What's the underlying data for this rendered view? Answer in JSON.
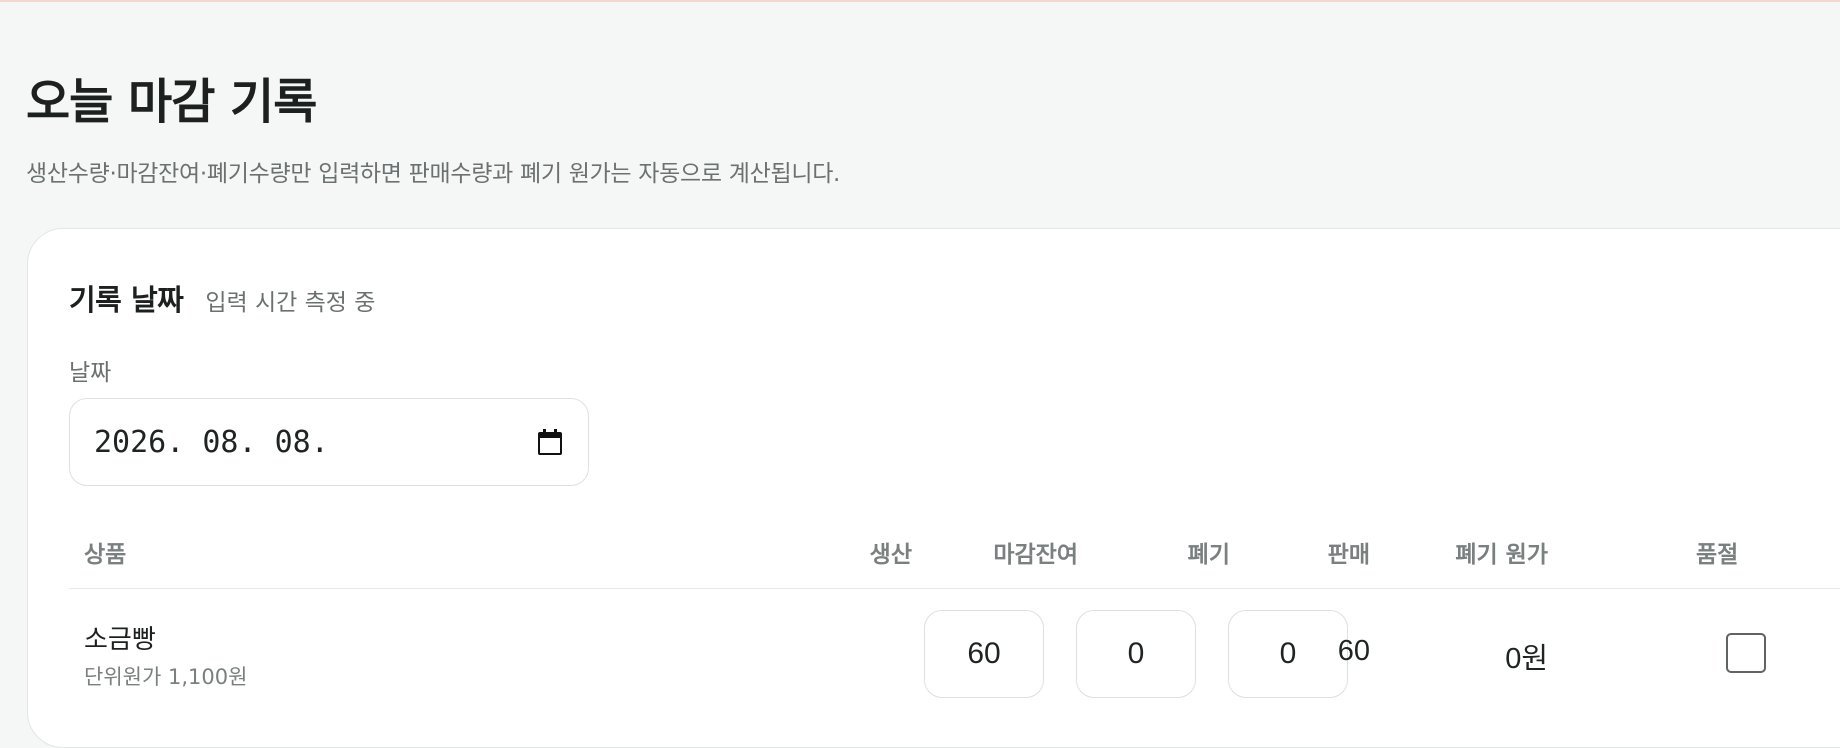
{
  "header": {
    "title": "오늘 마감 기록",
    "subtitle": "생산수량·마감잔여·폐기수량만 입력하면 판매수량과 폐기 원가는 자동으로 계산됩니다."
  },
  "record_card": {
    "title": "기록 날짜",
    "note": "입력 시간 측정 중",
    "date_label": "날짜",
    "date_value": "2026. 08. 08."
  },
  "table": {
    "columns": {
      "product": "상품",
      "produced": "생산",
      "remaining": "마감잔여",
      "waste": "폐기",
      "sold": "판매",
      "waste_cost": "폐기 원가",
      "sold_out": "품절"
    },
    "rows": [
      {
        "name": "소금빵",
        "unit_cost": "단위원가 1,100원",
        "produced": "60",
        "remaining": "0",
        "waste": "0",
        "sold": "60",
        "waste_cost": "0원",
        "sold_out": false
      }
    ]
  },
  "icons": {
    "date_picker": "calendar-icon"
  },
  "colors": {
    "background": "#f5f7f6",
    "card": "#ffffff",
    "muted_text": "#6b7170",
    "accent_line": "#f3d6d0"
  }
}
